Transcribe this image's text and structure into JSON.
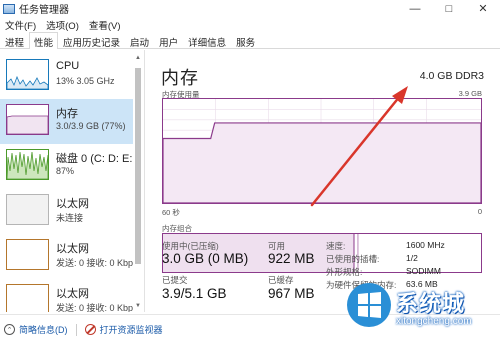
{
  "window": {
    "title": "任务管理器",
    "controls": [
      "—",
      "□",
      "✕"
    ]
  },
  "menu": [
    "文件(F)",
    "选项(O)",
    "查看(V)"
  ],
  "tabs": [
    "进程",
    "性能",
    "应用历史记录",
    "启动",
    "用户",
    "详细信息",
    "服务"
  ],
  "active_tab": "性能",
  "sidebar": {
    "items": [
      {
        "name": "CPU",
        "detail": "13% 3.05 GHz"
      },
      {
        "name": "内存",
        "detail": "3.0/3.9 GB (77%)"
      },
      {
        "name": "磁盘 0 (C: D: E:",
        "detail": "87%"
      },
      {
        "name": "以太网",
        "detail": "未连接"
      },
      {
        "name": "以太网",
        "detail": "发送: 0 接收: 0 Kbp"
      },
      {
        "name": "以太网",
        "detail": "发送: 0 接收: 0 Kbp"
      }
    ]
  },
  "panel": {
    "title": "内存",
    "spec": "4.0 GB DDR3",
    "usage_label": "内存使用量",
    "usage_max": "3.9 GB",
    "time_left": "60 秒",
    "time_right": "0",
    "composition_label": "内存组合",
    "usage_fraction": 0.77
  },
  "stats": {
    "in_use_label": "使用中(已压缩)",
    "in_use_value": "3.0 GB (0 MB)",
    "available_label": "可用",
    "available_value": "922 MB",
    "committed_label": "已提交",
    "committed_value": "3.9/5.1 GB",
    "cached_label": "已缓存",
    "cached_value": "967 MB"
  },
  "details": [
    {
      "k": "速度:",
      "v": "1600 MHz"
    },
    {
      "k": "已使用的插槽:",
      "v": "1/2"
    },
    {
      "k": "外形规格:",
      "v": "SODIMM"
    },
    {
      "k": "为硬件保留的内存:",
      "v": "63.6 MB"
    }
  ],
  "footer": {
    "brief": "简略信息(D)",
    "open_monitor": "打开资源监视器"
  },
  "watermark": {
    "text": "系统城",
    "url": "xitongcheng.com"
  },
  "colors": {
    "memory_line": "#8b3a8b",
    "selected_bg": "#cce4f7",
    "arrow": "#d9362b"
  }
}
